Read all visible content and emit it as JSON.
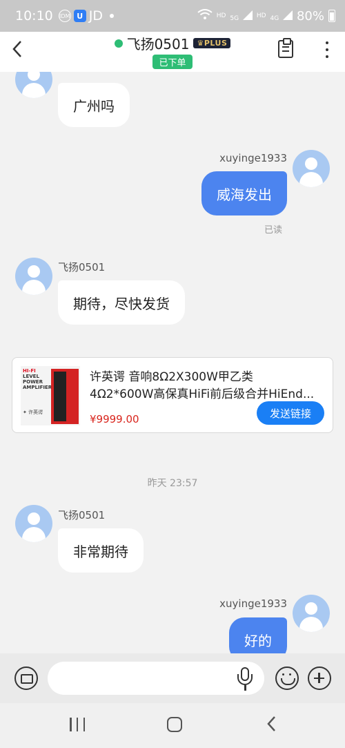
{
  "status_bar": {
    "time": "10:10",
    "app_badges": [
      "IDM",
      "U",
      "JD"
    ],
    "signal_labels": [
      "HD",
      "5G",
      "HD",
      "4G"
    ],
    "battery": "80%"
  },
  "header": {
    "title": "飞扬0501",
    "member_badge": "PLUS",
    "order_status": "已下单",
    "online_color": "#2ebd75"
  },
  "messages": [
    {
      "direction": "in",
      "sender": "",
      "text": "广州吗"
    },
    {
      "direction": "out",
      "sender": "xuyinge1933",
      "text": "威海发出",
      "read": "已读"
    },
    {
      "direction": "in",
      "sender": "飞扬0501",
      "text": "期待，尽快发货"
    },
    {
      "direction": "in",
      "sender": "飞扬0501",
      "text": "非常期待"
    },
    {
      "direction": "out",
      "sender": "xuyinge1933",
      "text": "好的"
    }
  ],
  "product": {
    "title_line1": "许英谔 音响8Ω2X300W甲乙类",
    "title_line2": "4Ω2*600W高保真HiFi前后级合并HiEnd...",
    "price": "¥9999.00",
    "send_button": "发送链接",
    "image_text": {
      "line1": "HI-FI",
      "line2": "LEVEL",
      "line3": "POWER",
      "line4": "AMPLIFIER",
      "brand": "许英谔"
    }
  },
  "timestamp": "昨天 23:57",
  "input": {
    "placeholder": ""
  },
  "colors": {
    "accent": "#4c84ef",
    "send_button": "#1a7ff5",
    "price": "#d9251d"
  }
}
